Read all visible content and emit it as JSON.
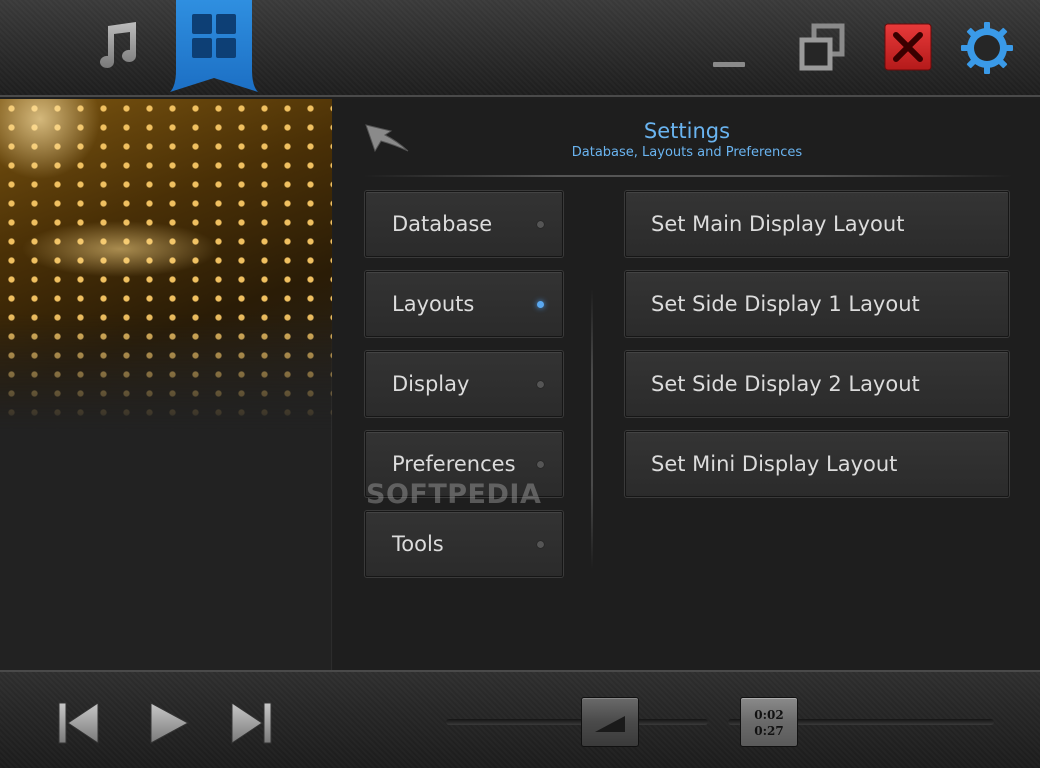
{
  "topbar": {
    "icons": {
      "music": "music-note-icon",
      "layout": "layout-grid-icon",
      "minimize": "minimize-icon",
      "restore": "restore-window-icon",
      "close": "close-icon",
      "settings": "gear-icon"
    },
    "colors": {
      "accent": "#2f8fe0",
      "close": "#d42828"
    }
  },
  "main": {
    "title": "Settings",
    "subtitle": "Database, Layouts and Preferences",
    "back_icon": "back-arrow-icon",
    "menu": [
      {
        "label": "Database",
        "active": false
      },
      {
        "label": "Layouts",
        "active": true
      },
      {
        "label": "Display",
        "active": false
      },
      {
        "label": "Preferences",
        "active": false
      },
      {
        "label": "Tools",
        "active": false
      }
    ],
    "actions": [
      {
        "label": "Set Main Display Layout"
      },
      {
        "label": "Set Side Display 1 Layout"
      },
      {
        "label": "Set Side Display 2 Layout"
      },
      {
        "label": "Set Mini Display Layout"
      }
    ],
    "watermark": "SOFTPEDIA"
  },
  "controls": {
    "icons": {
      "prev": "skip-previous-icon",
      "play": "play-icon",
      "next": "skip-next-icon",
      "volume": "volume-ramp-icon"
    },
    "time_elapsed": "0:02",
    "time_total": "0:27"
  }
}
